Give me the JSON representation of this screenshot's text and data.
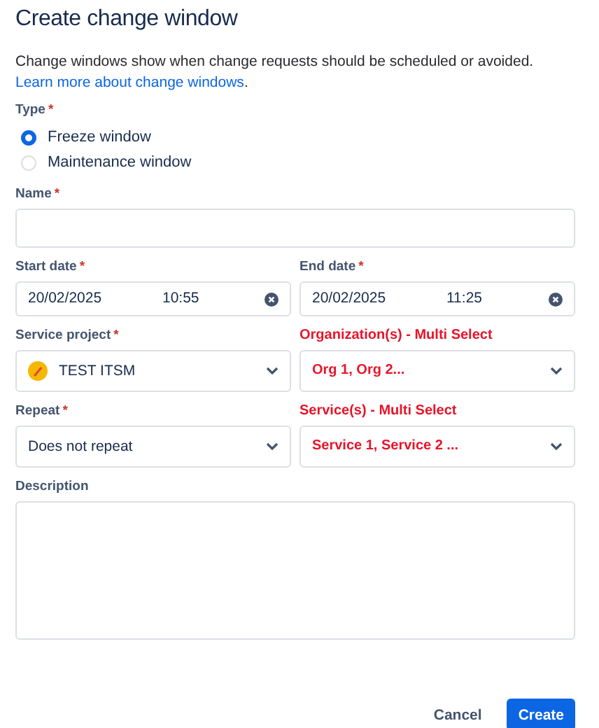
{
  "title": "Create change window",
  "intro": "Change windows show when change requests should be scheduled or avoided.",
  "learn_link": "Learn more about change windows",
  "link_end": ".",
  "type": {
    "label": "Type",
    "required_mark": "*",
    "options": [
      {
        "label": "Freeze window",
        "selected": true
      },
      {
        "label": "Maintenance window",
        "selected": false
      }
    ]
  },
  "name": {
    "label": "Name",
    "required_mark": "*"
  },
  "start_date": {
    "label": "Start date",
    "required_mark": "*",
    "date": "20/02/2025",
    "time": "10:55"
  },
  "end_date": {
    "label": "End date",
    "required_mark": "*",
    "date": "20/02/2025",
    "time": "11:25"
  },
  "service_project": {
    "label": "Service project",
    "required_mark": "*",
    "value": "TEST ITSM",
    "annotated": false
  },
  "organizations": {
    "label": "Organization(s) - Multi Select",
    "value": "Org 1, Org 2...",
    "annotated": true
  },
  "repeat": {
    "label": "Repeat",
    "required_mark": "*",
    "value": "Does not repeat",
    "annotated": false
  },
  "services": {
    "label": "Service(s) - Multi Select",
    "value": "Service 1, Service 2 ...",
    "annotated": true
  },
  "description": {
    "label": "Description"
  },
  "buttons": {
    "cancel": "Cancel",
    "create": "Create"
  }
}
